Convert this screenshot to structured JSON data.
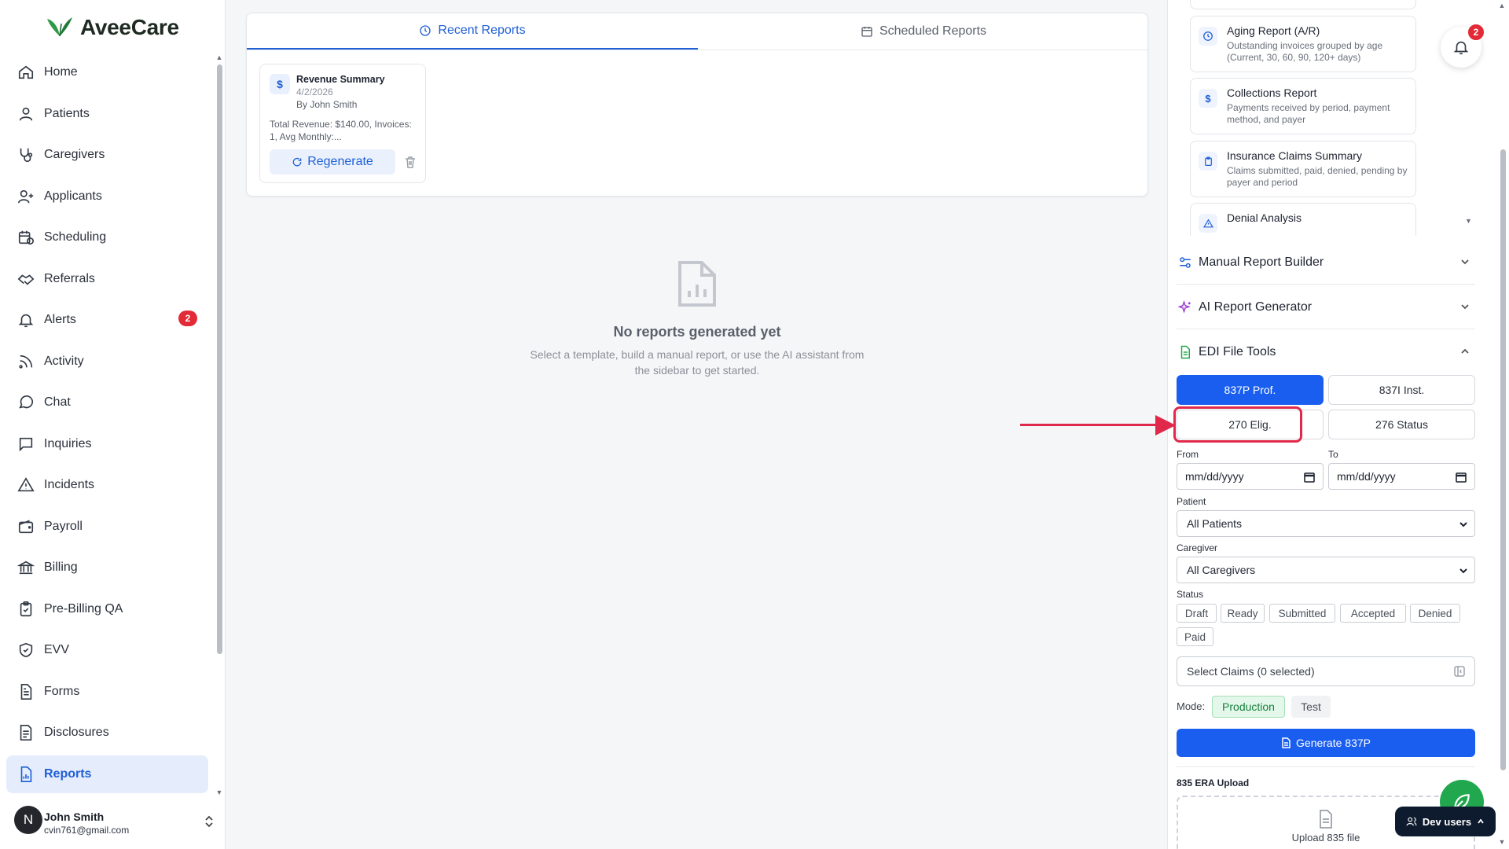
{
  "app": {
    "logo": "AveeCare"
  },
  "sidebar": {
    "items": [
      {
        "label": "Home",
        "icon": "home-icon"
      },
      {
        "label": "Patients",
        "icon": "user-icon"
      },
      {
        "label": "Caregivers",
        "icon": "stethoscope-icon"
      },
      {
        "label": "Applicants",
        "icon": "user-plus-icon"
      },
      {
        "label": "Scheduling",
        "icon": "calendar-clock-icon"
      },
      {
        "label": "Referrals",
        "icon": "handshake-icon"
      },
      {
        "label": "Alerts",
        "icon": "bell-icon",
        "badge": "2"
      },
      {
        "label": "Activity",
        "icon": "rss-icon"
      },
      {
        "label": "Chat",
        "icon": "chat-icon"
      },
      {
        "label": "Inquiries",
        "icon": "message-square-icon"
      },
      {
        "label": "Incidents",
        "icon": "warning-icon"
      },
      {
        "label": "Payroll",
        "icon": "wallet-icon"
      },
      {
        "label": "Billing",
        "icon": "bank-icon"
      },
      {
        "label": "Pre-Billing QA",
        "icon": "clipboard-check-icon"
      },
      {
        "label": "EVV",
        "icon": "shield-check-icon"
      },
      {
        "label": "Forms",
        "icon": "file-text-icon"
      },
      {
        "label": "Disclosures",
        "icon": "file-lines-icon"
      },
      {
        "label": "Reports",
        "icon": "file-chart-icon",
        "active": true
      }
    ],
    "user": {
      "initial": "N",
      "name": "John Smith",
      "email": "cvin761@gmail.com"
    }
  },
  "main": {
    "tabs": [
      {
        "label": "Recent Reports",
        "active": true,
        "icon": "clock-icon"
      },
      {
        "label": "Scheduled Reports",
        "active": false,
        "icon": "calendar-icon"
      }
    ],
    "report_card": {
      "icon": "$",
      "title": "Revenue Summary",
      "date": "4/2/2026",
      "by": "By John Smith",
      "description": "Total Revenue: $140.00, Invoices: 1, Avg Monthly:...",
      "regenerate_label": "Regenerate"
    },
    "empty_state": {
      "title": "No reports generated yet",
      "description": "Select a template, build a manual report, or use the AI assistant from the sidebar to get started."
    }
  },
  "right_panel": {
    "templates": [
      {
        "title": "Aging Report (A/R)",
        "description": "Outstanding invoices grouped by age (Current, 30, 60, 90, 120+ days)",
        "icon": "clock-icon"
      },
      {
        "title": "Collections Report",
        "description": "Payments received by period, payment method, and payer",
        "icon": "dollar-icon"
      },
      {
        "title": "Insurance Claims Summary",
        "description": "Claims submitted, paid, denied, pending by payer and period",
        "icon": "clipboard-icon"
      },
      {
        "title": "Denial Analysis",
        "description": "",
        "icon": "warning-icon"
      }
    ],
    "sections": {
      "manual": "Manual Report Builder",
      "ai": "AI Report Generator",
      "edi": "EDI File Tools"
    },
    "edi": {
      "types": [
        "837P Prof.",
        "837I Inst.",
        "270 Elig.",
        "276 Status"
      ],
      "active_type": "837P Prof.",
      "from_label": "From",
      "to_label": "To",
      "date_placeholder": "mm/dd/yyyy",
      "patient_label": "Patient",
      "patient_value": "All Patients",
      "caregiver_label": "Caregiver",
      "caregiver_value": "All Caregivers",
      "status_label": "Status",
      "statuses": [
        "Draft",
        "Ready",
        "Submitted",
        "Accepted",
        "Denied",
        "Paid"
      ],
      "claims_label": "Select Claims (0 selected)",
      "mode_label": "Mode:",
      "mode_production": "Production",
      "mode_test": "Test",
      "generate_label": "Generate 837P",
      "era_label": "835 ERA Upload",
      "upload_label": "Upload 835 file"
    }
  },
  "floating": {
    "bell_badge": "2",
    "dev_users_label": "Dev users"
  },
  "colors": {
    "accent": "#1a5ef0",
    "badge": "#e22b36",
    "annotation": "#e0284a",
    "fab": "#21a84e"
  }
}
